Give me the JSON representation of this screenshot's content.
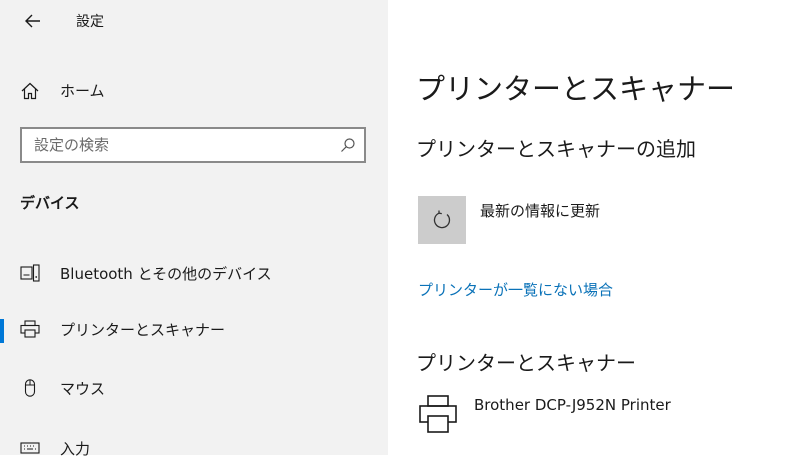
{
  "window": {
    "title": "設定",
    "back_icon": "back-arrow-icon"
  },
  "sidebar": {
    "home": {
      "label": "ホーム",
      "icon": "home-icon"
    },
    "search": {
      "placeholder": "設定の検索",
      "value": "",
      "icon": "search-icon"
    },
    "section_title": "デバイス",
    "items": [
      {
        "label": "Bluetooth とその他のデバイス",
        "icon": "bluetooth-devices-icon",
        "selected": false
      },
      {
        "label": "プリンターとスキャナー",
        "icon": "printer-icon",
        "selected": true
      },
      {
        "label": "マウス",
        "icon": "mouse-icon",
        "selected": false
      },
      {
        "label": "入力",
        "icon": "keyboard-icon",
        "selected": false
      }
    ]
  },
  "main": {
    "title": "プリンターとスキャナー",
    "add_section_title": "プリンターとスキャナーの追加",
    "refresh": {
      "label": "最新の情報に更新",
      "icon": "refresh-icon"
    },
    "not_listed_link": "プリンターが一覧にない場合",
    "list_title": "プリンターとスキャナー",
    "devices": [
      {
        "name": "Brother DCP-J952N Printer",
        "icon": "printer-icon"
      }
    ]
  },
  "colors": {
    "sidebar_bg": "#f2f2f2",
    "accent": "#0078d7",
    "link": "#0a72b8",
    "refresh_button_bg": "#cccccc"
  }
}
